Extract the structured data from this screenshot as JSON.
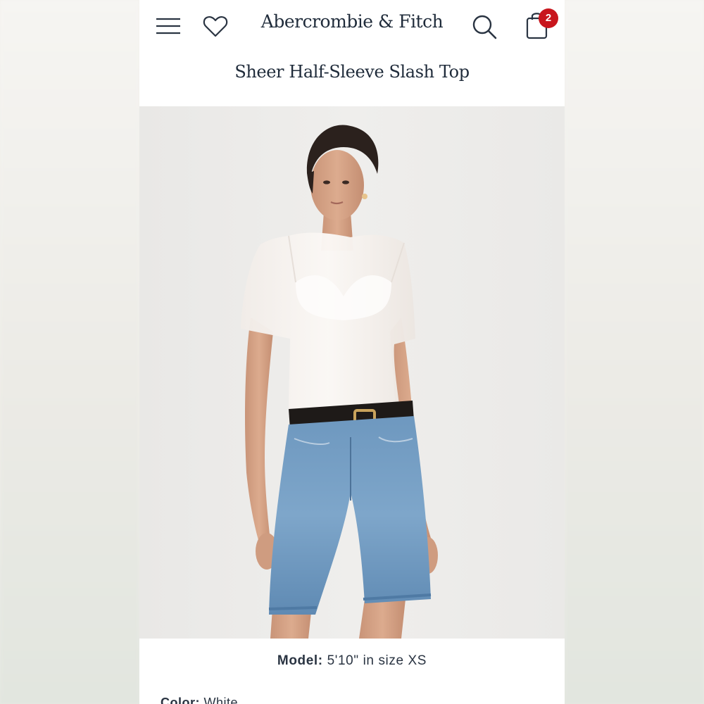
{
  "header": {
    "brand": "Abercrombie & Fitch",
    "bag_count": "2",
    "icons": {
      "menu": "hamburger-menu-icon",
      "wishlist": "heart-icon",
      "search": "search-icon",
      "bag": "shopping-bag-icon"
    }
  },
  "product": {
    "title": "Sheer Half-Sleeve Slash Top",
    "model_label": "Model:",
    "model_value": "5'10\" in size XS",
    "color_label": "Color:",
    "color_value": "White"
  },
  "colors": {
    "text": "#1f2b3a",
    "badge": "#c8161d"
  }
}
